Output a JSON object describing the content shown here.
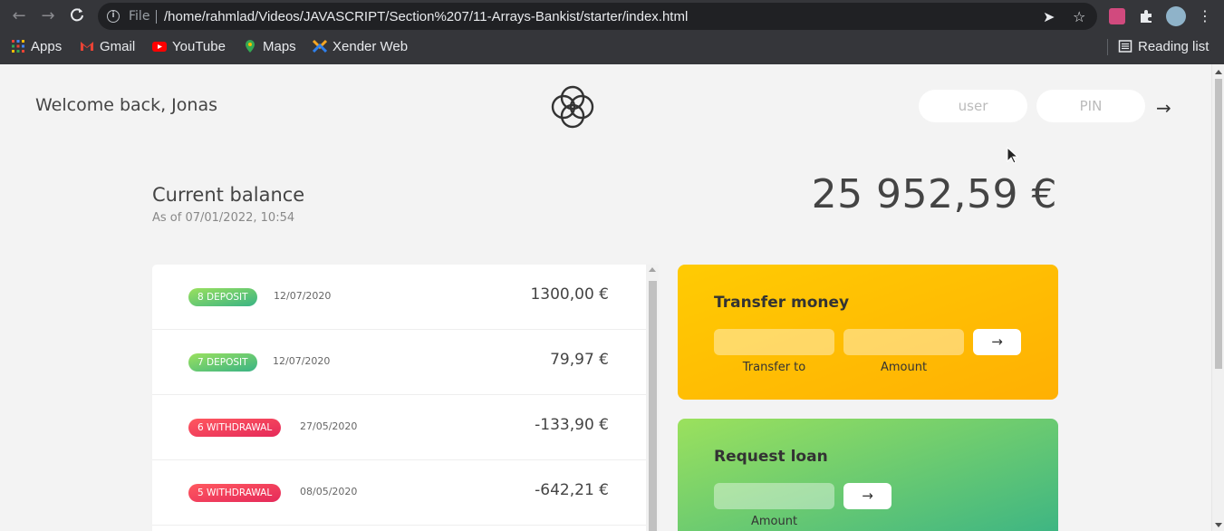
{
  "browser": {
    "url_scheme": "File",
    "url": "/home/rahmlad/Videos/JAVASCRIPT/Section%207/11-Arrays-Bankist/starter/index.html",
    "bookmarks": [
      {
        "label": "Apps",
        "icon": "apps-grid-icon"
      },
      {
        "label": "Gmail",
        "icon": "gmail-icon"
      },
      {
        "label": "YouTube",
        "icon": "youtube-icon"
      },
      {
        "label": "Maps",
        "icon": "maps-icon"
      },
      {
        "label": "Xender Web",
        "icon": "xender-icon"
      }
    ],
    "reading_list": "Reading list"
  },
  "nav": {
    "welcome": "Welcome back, Jonas",
    "user_placeholder": "user",
    "pin_placeholder": "PIN",
    "login_arrow": "→"
  },
  "balance": {
    "label": "Current balance",
    "date_prefix": "As of",
    "date": "As of 07/01/2022, 10:54",
    "value": "25 952,59 €"
  },
  "movements": [
    {
      "type": "8 deposit",
      "kind": "deposit",
      "date": "12/07/2020",
      "value": "1300,00 €"
    },
    {
      "type": "7 deposit",
      "kind": "deposit",
      "date": "12/07/2020",
      "value": "79,97 €"
    },
    {
      "type": "6 withdrawal",
      "kind": "withdrawal",
      "date": "27/05/2020",
      "value": "-133,90 €"
    },
    {
      "type": "5 withdrawal",
      "kind": "withdrawal",
      "date": "08/05/2020",
      "value": "-642,21 €"
    }
  ],
  "operations": {
    "transfer": {
      "title": "Transfer money",
      "to_label": "Transfer to",
      "amount_label": "Amount",
      "button": "→"
    },
    "loan": {
      "title": "Request loan",
      "amount_label": "Amount",
      "button": "→"
    }
  },
  "colors": {
    "deposit": "#39b385",
    "withdrawal": "#e52a5a",
    "transfer": "#ffb003",
    "loan": "#39b385"
  }
}
